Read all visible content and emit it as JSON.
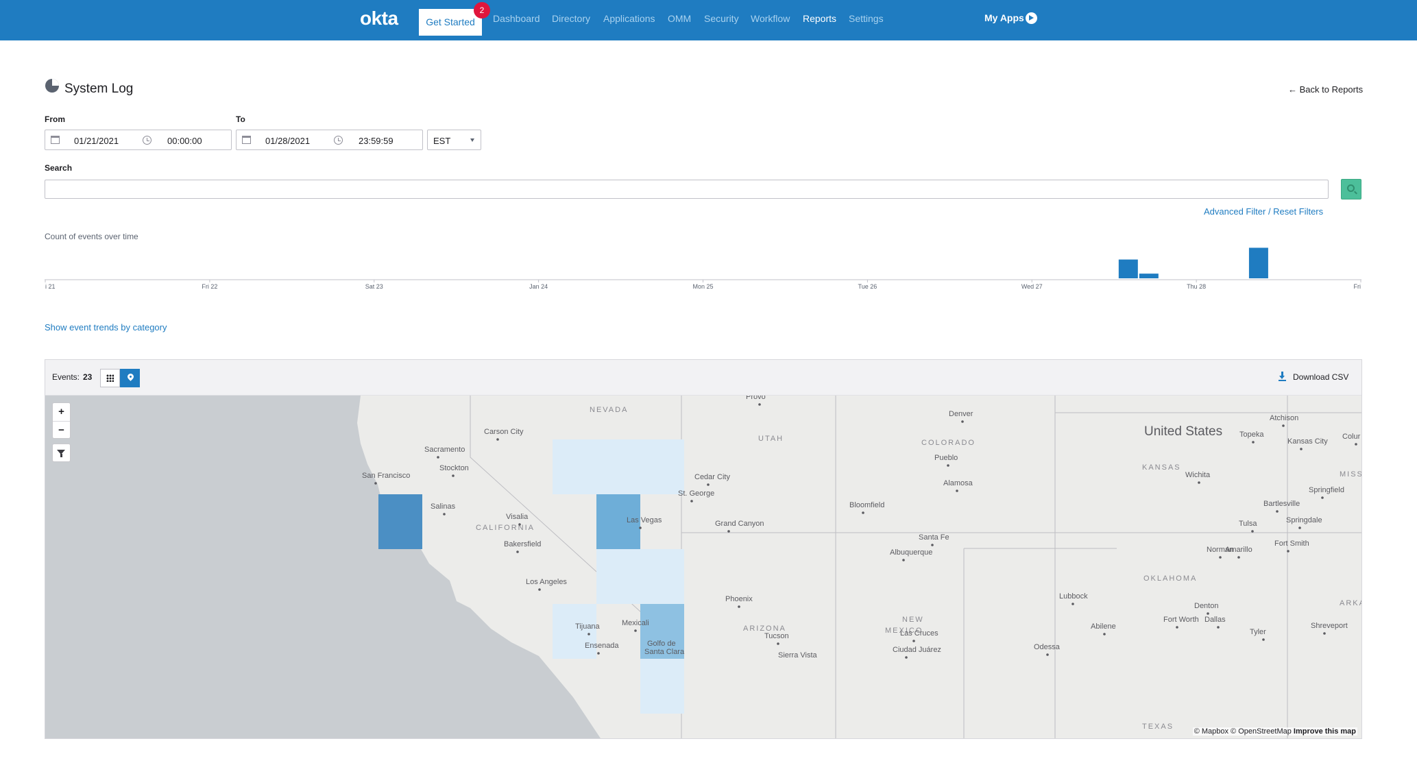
{
  "nav": {
    "logo": "okta",
    "get_started": "Get Started",
    "badge_count": "2",
    "items": [
      "Dashboard",
      "Directory",
      "Applications",
      "OMM",
      "Security",
      "Workflow",
      "Reports",
      "Settings"
    ],
    "active_item": "Reports",
    "my_apps": "My Apps",
    "my_apps_icon": "arrow-circle-right-icon",
    "colors": {
      "bar": "#1f7cc1",
      "badge": "#e0163d"
    }
  },
  "header": {
    "title": "System Log",
    "title_icon": "pie-chart-icon",
    "back_link": "← Back to Reports"
  },
  "date_range": {
    "from_label": "From",
    "from_date": "01/21/2021",
    "from_time": "00:00:00",
    "to_label": "To",
    "to_date": "01/28/2021",
    "to_time": "23:59:59",
    "timezone": "EST"
  },
  "search": {
    "label": "Search",
    "value": "",
    "placeholder": "",
    "button_icon": "search-icon",
    "advanced_filter": "Advanced Filter",
    "separator": " / ",
    "reset_filters": "Reset Filters"
  },
  "histogram": {
    "title": "Count of events over time",
    "show_trends": "Show event trends by category"
  },
  "chart_data": {
    "type": "bar",
    "title": "Count of events over time",
    "x_ticks": [
      "i 21",
      "Fri 22",
      "Sat 23",
      "Jan 24",
      "Mon 25",
      "Tue 26",
      "Wed 27",
      "Thu 28",
      "Fri"
    ],
    "x_range": [
      "2021-01-21",
      "2021-01-29"
    ],
    "bars": [
      {
        "x": "2021-01-27 14:00",
        "value": 8
      },
      {
        "x": "2021-01-27 17:00",
        "value": 2
      },
      {
        "x": "2021-01-28 09:00",
        "value": 13
      }
    ],
    "ylim": [
      0,
      14
    ],
    "grid": false,
    "bar_color": "#1f7cc1"
  },
  "events": {
    "label": "Events:",
    "count": "23",
    "view_table_icon": "grid-icon",
    "view_map_icon": "map-pin-icon",
    "download": "Download CSV",
    "download_icon": "download-icon"
  },
  "map": {
    "zoom_in": "+",
    "zoom_out": "−",
    "filter_icon": "funnel-icon",
    "attribution": "© Mapbox © OpenStreetMap",
    "improve": "Improve this map",
    "country": "United States",
    "states": [
      "NEVADA",
      "UTAH",
      "COLORADO",
      "KANSAS",
      "MISSOU",
      "CALIFORNIA",
      "OKLAHOMA",
      "ARKAN",
      "ARIZONA",
      "NEW",
      "MEXICO",
      "TEXAS"
    ],
    "cities": [
      "Provo",
      "Denver",
      "Atchison",
      "Carson City",
      "Topeka",
      "Kansas City",
      "Colur",
      "Sacramento",
      "Pueblo",
      "Stockton",
      "Wichita",
      "San Francisco",
      "Cedar City",
      "Alamosa",
      "Springfield",
      "St. George",
      "Salinas",
      "Bloomfield",
      "Bartlesville",
      "Visalia",
      "Las Vegas",
      "Grand Canyon",
      "Tulsa",
      "Springdale",
      "Santa Fe",
      "Fort Smith",
      "Bakersfield",
      "Albuquerque",
      "Amarillo",
      "Norman",
      "Los Angeles",
      "Phoenix",
      "Lubbock",
      "Denton",
      "Tijuana",
      "Mexicali",
      "Fort Worth",
      "Dallas",
      "Abilene",
      "Shreveport",
      "Las Cruces",
      "Tyler",
      "Tucson",
      "Ensenada",
      "Golfo de",
      "Santa Clara",
      "Sierra Vista",
      "Ciudad Juárez",
      "Odessa"
    ],
    "heat_colors": [
      "#4b8fc4",
      "#6eaed8",
      "#8ec1e2",
      "#cfe5f5",
      "#dcecf8"
    ]
  }
}
